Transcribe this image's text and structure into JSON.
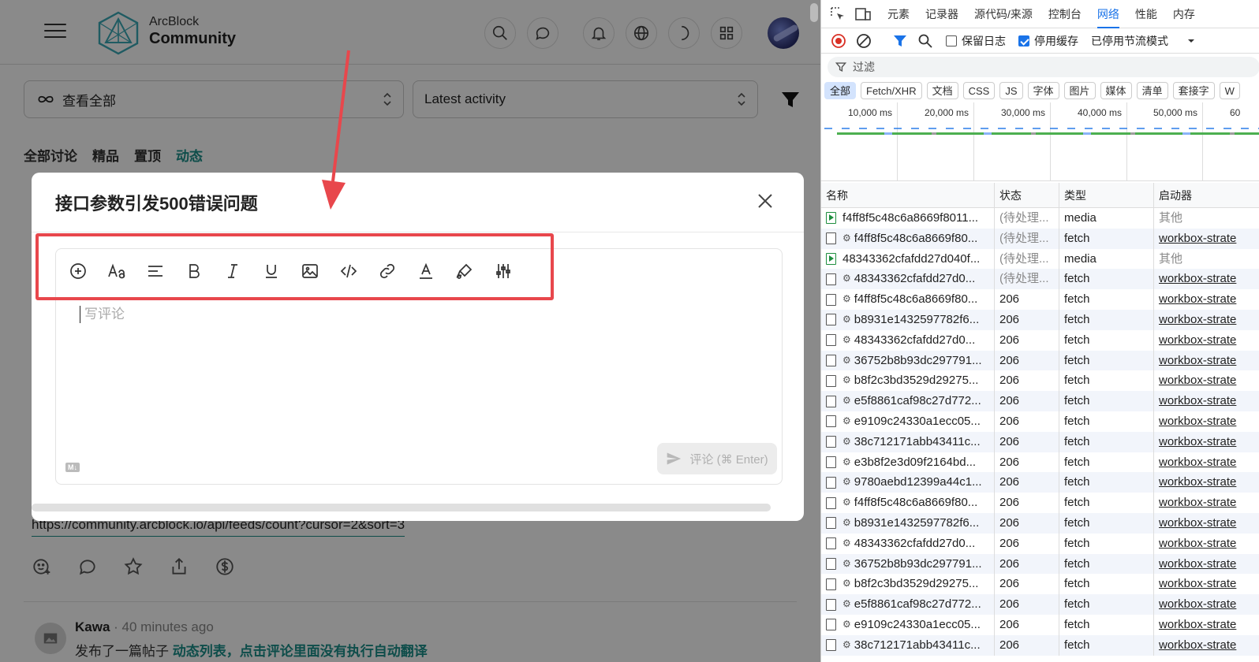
{
  "header": {
    "logo_line1": "ArcBlock",
    "logo_line2": "Community"
  },
  "filters": {
    "scope": "查看全部",
    "sort": "Latest activity"
  },
  "tabs": [
    {
      "label": "全部讨论",
      "active": false
    },
    {
      "label": "精品",
      "active": false
    },
    {
      "label": "置顶",
      "active": false
    },
    {
      "label": "动态",
      "active": true
    }
  ],
  "post": {
    "link": "https://community.arcblock.io/api/feeds/count?cursor=2&sort=3"
  },
  "feed": {
    "user": "Kawa",
    "time": "40 minutes ago",
    "action": "发布了一篇帖子",
    "title": "动态列表，点击评论里面没有执行自动翻译"
  },
  "modal": {
    "title": "接口参数引发500错误问题",
    "placeholder": "写评论",
    "markdown_badge": "M↓",
    "submit_label": "评论 (⌘ Enter)",
    "toolbar": [
      "add-icon",
      "font-size-icon",
      "align-icon",
      "bold-icon",
      "italic-icon",
      "underline-icon",
      "image-icon",
      "code-icon",
      "link-icon",
      "text-color-icon",
      "highlight-icon",
      "settings-sliders-icon"
    ]
  },
  "devtools": {
    "tabs": [
      {
        "label": "元素",
        "active": false
      },
      {
        "label": "记录器",
        "active": false
      },
      {
        "label": "源代码/来源",
        "active": false
      },
      {
        "label": "控制台",
        "active": false
      },
      {
        "label": "网络",
        "active": true
      },
      {
        "label": "性能",
        "active": false
      },
      {
        "label": "内存",
        "active": false
      }
    ],
    "preserve_log": "保留日志",
    "disable_cache": "停用缓存",
    "throttle": "已停用节流模式",
    "filter_placeholder": "过滤",
    "chips": [
      "全部",
      "Fetch/XHR",
      "文档",
      "CSS",
      "JS",
      "字体",
      "图片",
      "媒体",
      "清单",
      "套接字",
      "W"
    ],
    "timeline_labels": [
      "10,000 ms",
      "20,000 ms",
      "30,000 ms",
      "40,000 ms",
      "50,000 ms",
      "60"
    ],
    "columns": [
      "名称",
      "状态",
      "类型",
      "启动器"
    ],
    "rows": [
      {
        "name": "f4ff8f5c48c6a8669f8011...",
        "status": "(待处理...",
        "type": "media",
        "initiator": "其他",
        "kind": "media"
      },
      {
        "name": "f4ff8f5c48c6a8669f80...",
        "status": "(待处理...",
        "type": "fetch",
        "initiator": "workbox-strate",
        "kind": "fetch"
      },
      {
        "name": "48343362cfafdd27d040f...",
        "status": "(待处理...",
        "type": "media",
        "initiator": "其他",
        "kind": "media"
      },
      {
        "name": "48343362cfafdd27d0...",
        "status": "(待处理...",
        "type": "fetch",
        "initiator": "workbox-strate",
        "kind": "fetch"
      },
      {
        "name": "f4ff8f5c48c6a8669f80...",
        "status": "206",
        "type": "fetch",
        "initiator": "workbox-strate",
        "kind": "fetch"
      },
      {
        "name": "b8931e1432597782f6...",
        "status": "206",
        "type": "fetch",
        "initiator": "workbox-strate",
        "kind": "fetch"
      },
      {
        "name": "48343362cfafdd27d0...",
        "status": "206",
        "type": "fetch",
        "initiator": "workbox-strate",
        "kind": "fetch"
      },
      {
        "name": "36752b8b93dc297791...",
        "status": "206",
        "type": "fetch",
        "initiator": "workbox-strate",
        "kind": "fetch"
      },
      {
        "name": "b8f2c3bd3529d29275...",
        "status": "206",
        "type": "fetch",
        "initiator": "workbox-strate",
        "kind": "fetch"
      },
      {
        "name": "e5f8861caf98c27d772...",
        "status": "206",
        "type": "fetch",
        "initiator": "workbox-strate",
        "kind": "fetch"
      },
      {
        "name": "e9109c24330a1ecc05...",
        "status": "206",
        "type": "fetch",
        "initiator": "workbox-strate",
        "kind": "fetch"
      },
      {
        "name": "38c712171abb43411c...",
        "status": "206",
        "type": "fetch",
        "initiator": "workbox-strate",
        "kind": "fetch"
      },
      {
        "name": "e3b8f2e3d09f2164bd...",
        "status": "206",
        "type": "fetch",
        "initiator": "workbox-strate",
        "kind": "fetch"
      },
      {
        "name": "9780aebd12399a44c1...",
        "status": "206",
        "type": "fetch",
        "initiator": "workbox-strate",
        "kind": "fetch"
      },
      {
        "name": "f4ff8f5c48c6a8669f80...",
        "status": "206",
        "type": "fetch",
        "initiator": "workbox-strate",
        "kind": "fetch"
      },
      {
        "name": "b8931e1432597782f6...",
        "status": "206",
        "type": "fetch",
        "initiator": "workbox-strate",
        "kind": "fetch"
      },
      {
        "name": "48343362cfafdd27d0...",
        "status": "206",
        "type": "fetch",
        "initiator": "workbox-strate",
        "kind": "fetch"
      },
      {
        "name": "36752b8b93dc297791...",
        "status": "206",
        "type": "fetch",
        "initiator": "workbox-strate",
        "kind": "fetch"
      },
      {
        "name": "b8f2c3bd3529d29275...",
        "status": "206",
        "type": "fetch",
        "initiator": "workbox-strate",
        "kind": "fetch"
      },
      {
        "name": "e5f8861caf98c27d772...",
        "status": "206",
        "type": "fetch",
        "initiator": "workbox-strate",
        "kind": "fetch"
      },
      {
        "name": "e9109c24330a1ecc05...",
        "status": "206",
        "type": "fetch",
        "initiator": "workbox-strate",
        "kind": "fetch"
      },
      {
        "name": "38c712171abb43411c...",
        "status": "206",
        "type": "fetch",
        "initiator": "workbox-strate",
        "kind": "fetch"
      }
    ]
  },
  "colors": {
    "accent": "#1a8f8a",
    "annotation": "#e8474c",
    "devtools_active": "#1a73e8"
  }
}
